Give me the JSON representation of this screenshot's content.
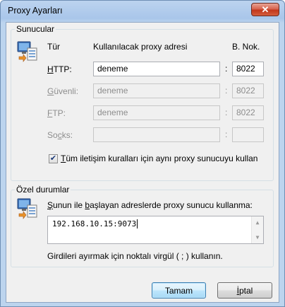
{
  "window": {
    "title": "Proxy Ayarları",
    "close_label": "✕"
  },
  "servers": {
    "legend": "Sunucular",
    "col_type": "Tür",
    "col_address": "Kullanılacak proxy adresi",
    "col_port": "B. Nok.",
    "rows": [
      {
        "label": "HTTP:",
        "address": "deneme",
        "port": "8022",
        "enabled": true
      },
      {
        "label": "Güvenli:",
        "address": "deneme",
        "port": "8022",
        "enabled": false
      },
      {
        "label": "FTP:",
        "address": "deneme",
        "port": "8022",
        "enabled": false
      },
      {
        "label": "Socks:",
        "address": "",
        "port": "",
        "enabled": false
      }
    ],
    "colon": ":",
    "same_proxy_checkbox": {
      "label": "Tüm iletişim kuralları için aynı proxy sunucuyu kullan",
      "checked": true,
      "check_glyph": "✔"
    }
  },
  "exceptions": {
    "legend": "Özel durumlar",
    "description": "Şunun ile başlayan adreslerde proxy sunucu kullanma:",
    "value": "192.168.10.15:9073",
    "hint": "Girdileri ayırmak için noktalı virgül ( ; ) kullanın."
  },
  "buttons": {
    "ok": "Tamam",
    "cancel": "İptal"
  },
  "colors": {
    "title_gradient": "#a9c6ea",
    "close_button": "#c2361b",
    "dialog_bg": "#f0f0f0",
    "default_button": "#bee6fd"
  }
}
